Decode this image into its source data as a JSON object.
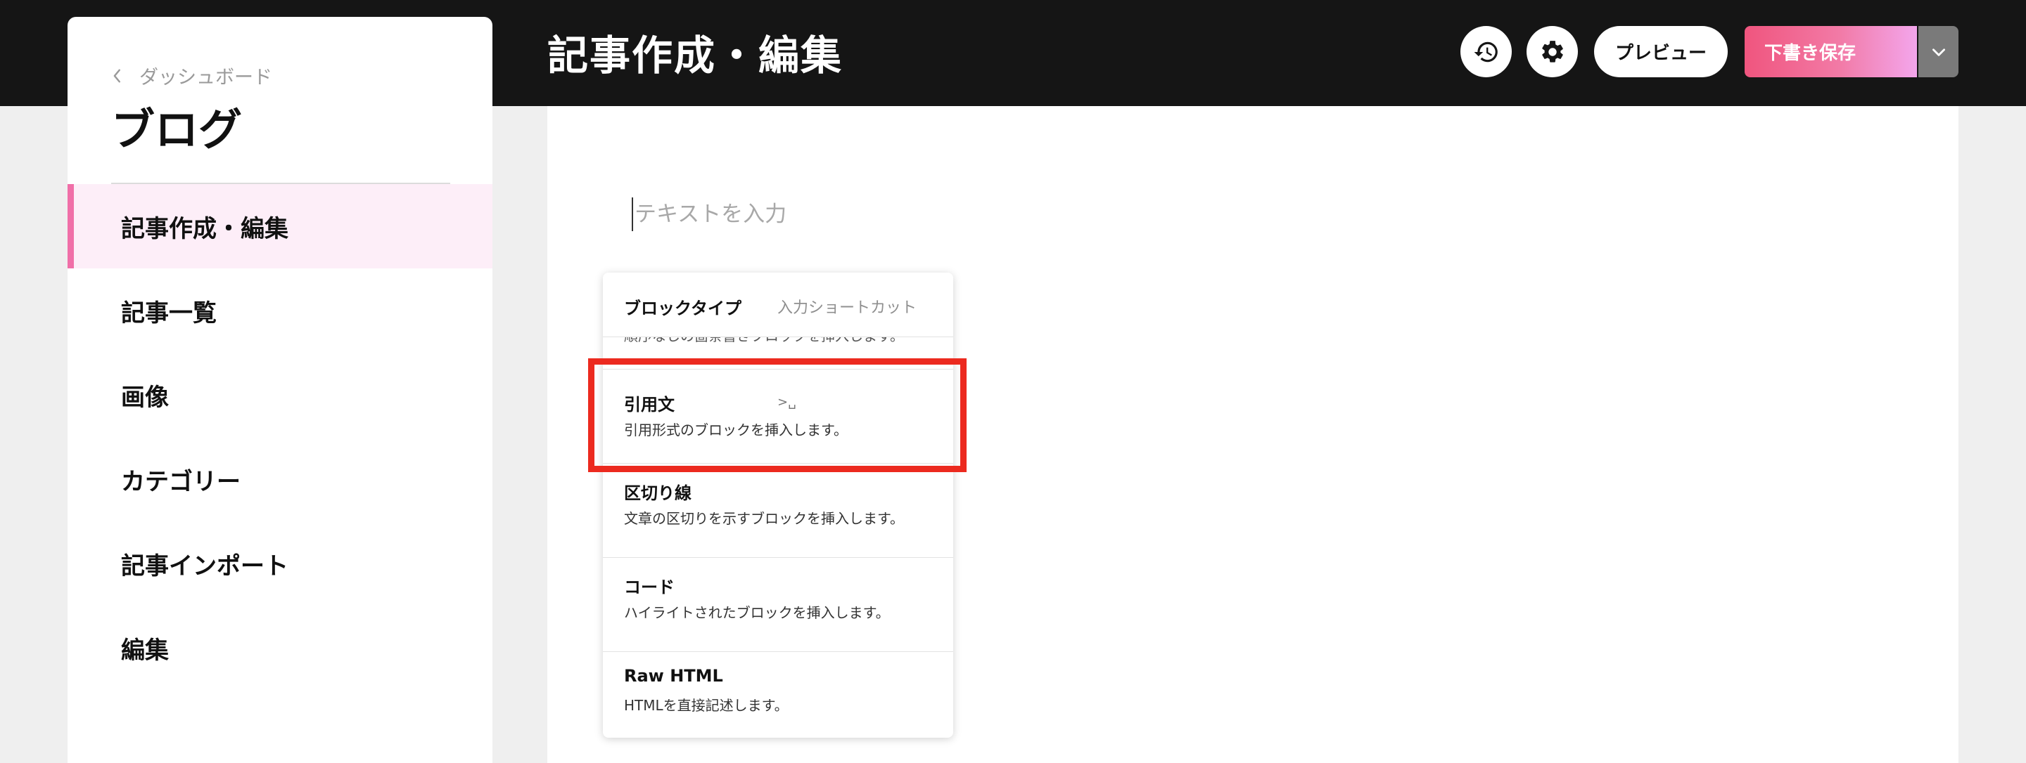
{
  "header": {
    "title": "記事作成・編集",
    "preview_label": "プレビュー",
    "save_label": "下書き保存",
    "history_icon": "history-icon",
    "settings_icon": "gear-icon",
    "toggle_icon": "chevron-down-icon"
  },
  "sidebar": {
    "back_label": "ダッシュボード",
    "title": "ブログ",
    "items": [
      {
        "label": "記事作成・編集",
        "active": true
      },
      {
        "label": "記事一覧",
        "active": false
      },
      {
        "label": "画像",
        "active": false
      },
      {
        "label": "カテゴリー",
        "active": false
      },
      {
        "label": "記事インポート",
        "active": false
      },
      {
        "label": "編集",
        "active": false
      }
    ]
  },
  "editor": {
    "placeholder": "テキストを入力"
  },
  "block_menu": {
    "header_type": "ブロックタイプ",
    "header_shortcut": "入力ショートカット",
    "cut_off_text": "順序なしの箇条書きブロックを挿入します。",
    "items": [
      {
        "name": "引用文",
        "shortcut": ">␣",
        "description": "引用形式のブロックを挿入します。"
      },
      {
        "name": "区切り線",
        "shortcut": "",
        "description": "文章の区切りを示すブロックを挿入します。"
      },
      {
        "name": "コード",
        "shortcut": "",
        "description": "ハイライトされたブロックを挿入します。"
      },
      {
        "name": "Raw HTML",
        "shortcut": "",
        "description": "HTMLを直接記述します。"
      }
    ]
  },
  "colors": {
    "topbar": "#151515",
    "accent": "#f06fa8",
    "save_gradient_start": "#f0557e",
    "save_gradient_end": "#f3a6ec",
    "highlight": "#ec2a1f"
  }
}
